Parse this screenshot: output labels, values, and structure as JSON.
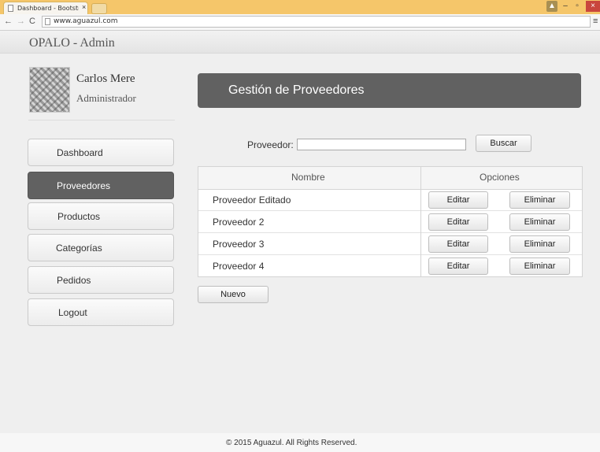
{
  "browser": {
    "tab_title": "Dashboard - Bootstrap A",
    "tab_close": "×",
    "url": "www.aguazul.com",
    "controls": {
      "user": "▲",
      "minimize": "–",
      "maximize": "▫",
      "close": "×"
    },
    "nav": {
      "back": "←",
      "forward": "→",
      "reload": "C",
      "menu": "≡"
    }
  },
  "header": {
    "brand": "OPALO - Admin"
  },
  "profile": {
    "name": "Carlos Mere",
    "role": "Administrador"
  },
  "sidebar": {
    "items": [
      {
        "label": "Dashboard"
      },
      {
        "label": "Proveedores",
        "active": true
      },
      {
        "label": "Productos"
      },
      {
        "label": "Categorías"
      },
      {
        "label": "Pedidos"
      },
      {
        "label": "Logout"
      }
    ]
  },
  "main": {
    "title": "Gestión de Proveedores",
    "search": {
      "label": "Proveedor:",
      "value": "",
      "button": "Buscar"
    },
    "table": {
      "headers": [
        "Nombre",
        "Opciones"
      ],
      "rows": [
        {
          "name": "Proveedor Editado",
          "edit": "Editar",
          "delete": "Eliminar"
        },
        {
          "name": "Proveedor 2",
          "edit": "Editar",
          "delete": "Eliminar"
        },
        {
          "name": "Proveedor 3",
          "edit": "Editar",
          "delete": "Eliminar"
        },
        {
          "name": "Proveedor 4",
          "edit": "Editar",
          "delete": "Eliminar"
        }
      ]
    },
    "new_button": "Nuevo"
  },
  "footer": {
    "text": "© 2015 Aguazul. All Rights Reserved."
  },
  "colors": {
    "active_nav": "#616161",
    "title_bar": "#616161",
    "tab_bar": "#f5c66a"
  }
}
